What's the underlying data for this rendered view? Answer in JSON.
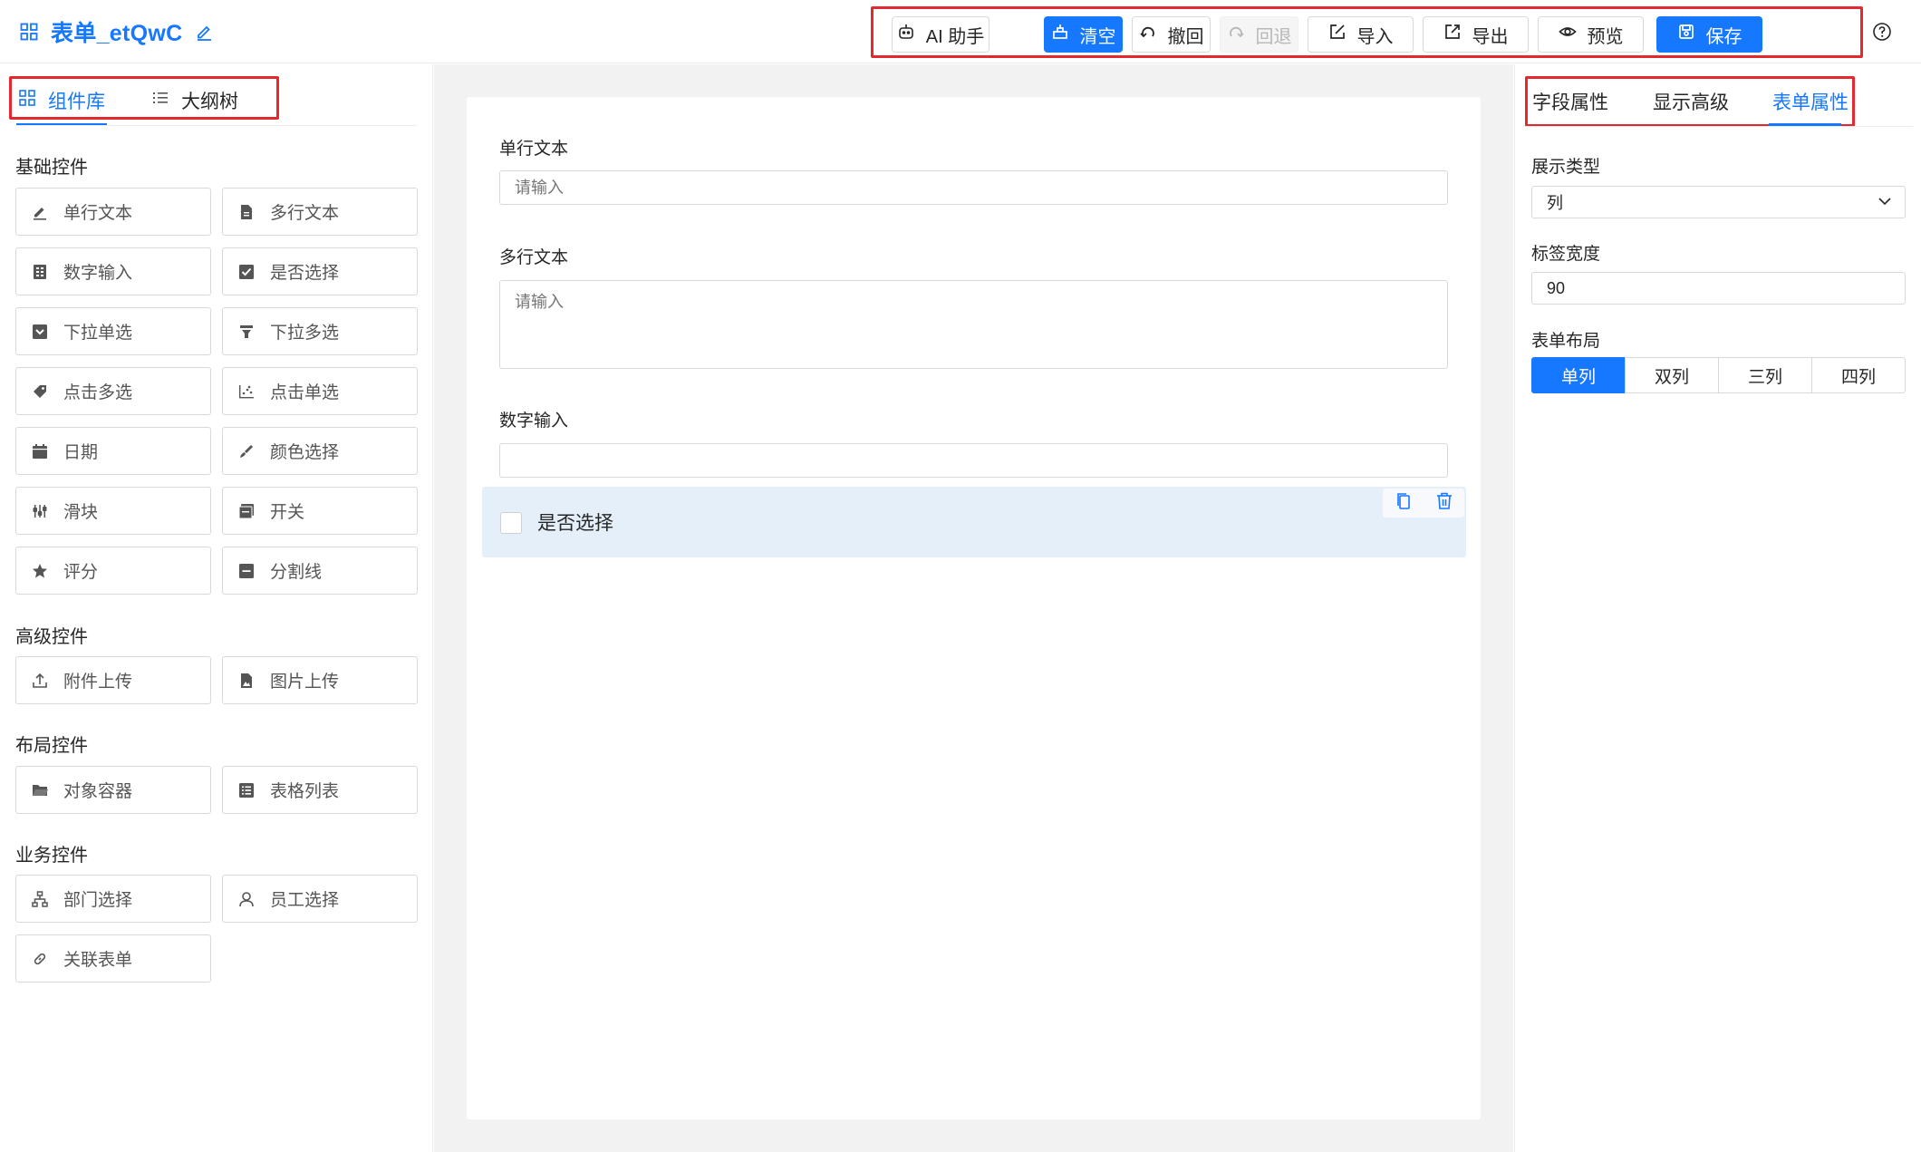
{
  "header": {
    "title": "表单_etQwC",
    "toolbar": [
      {
        "label": "AI 助手",
        "icon": "ai-robot-icon",
        "state": "default"
      },
      {
        "label": "清空",
        "icon": "clear-broom-icon",
        "state": "primary"
      },
      {
        "label": "撤回",
        "icon": "undo-icon",
        "state": "default"
      },
      {
        "label": "回退",
        "icon": "redo-icon",
        "state": "disabled"
      },
      {
        "label": "导入",
        "icon": "import-icon",
        "state": "default"
      },
      {
        "label": "导出",
        "icon": "export-icon",
        "state": "default"
      },
      {
        "label": "预览",
        "icon": "eye-icon",
        "state": "default"
      },
      {
        "label": "保存",
        "icon": "save-icon",
        "state": "primary"
      }
    ]
  },
  "left_panel": {
    "tabs": [
      {
        "label": "组件库",
        "icon": "grid-icon",
        "active": true
      },
      {
        "label": "大纲树",
        "icon": "list-icon",
        "active": false
      }
    ],
    "sections": {
      "basic": {
        "title": "基础控件",
        "items": [
          {
            "label": "单行文本",
            "icon": "pen-icon"
          },
          {
            "label": "多行文本",
            "icon": "document-icon"
          },
          {
            "label": "数字输入",
            "icon": "calculator-icon"
          },
          {
            "label": "是否选择",
            "icon": "checkbox-icon"
          },
          {
            "label": "下拉单选",
            "icon": "dropdown-square-icon"
          },
          {
            "label": "下拉多选",
            "icon": "filter-icon"
          },
          {
            "label": "点击多选",
            "icon": "tags-icon"
          },
          {
            "label": "点击单选",
            "icon": "scatter-icon"
          },
          {
            "label": "日期",
            "icon": "calendar-icon"
          },
          {
            "label": "颜色选择",
            "icon": "brush-icon"
          },
          {
            "label": "滑块",
            "icon": "slider-icon"
          },
          {
            "label": "开关",
            "icon": "switch-icon"
          },
          {
            "label": "评分",
            "icon": "star-icon"
          },
          {
            "label": "分割线",
            "icon": "divider-icon"
          }
        ]
      },
      "advanced": {
        "title": "高级控件",
        "items": [
          {
            "label": "附件上传",
            "icon": "upload-icon"
          },
          {
            "label": "图片上传",
            "icon": "image-file-icon"
          }
        ]
      },
      "layout": {
        "title": "布局控件",
        "items": [
          {
            "label": "对象容器",
            "icon": "folder-icon"
          },
          {
            "label": "表格列表",
            "icon": "table-list-icon"
          }
        ]
      },
      "business": {
        "title": "业务控件",
        "items": [
          {
            "label": "部门选择",
            "icon": "org-chart-icon"
          },
          {
            "label": "员工选择",
            "icon": "user-icon"
          },
          {
            "label": "关联表单",
            "icon": "link-icon"
          }
        ]
      }
    }
  },
  "canvas": {
    "fields": [
      {
        "label": "单行文本",
        "placeholder": "请输入"
      },
      {
        "label": "多行文本",
        "placeholder": "请输入"
      },
      {
        "label": "数字输入",
        "placeholder": ""
      }
    ],
    "checkbox_field": {
      "label": "是否选择",
      "checked": false,
      "selected": true
    }
  },
  "right_panel": {
    "tabs": [
      {
        "label": "字段属性",
        "active": false
      },
      {
        "label": "显示高级",
        "active": false
      },
      {
        "label": "表单属性",
        "active": true
      }
    ],
    "display_type": {
      "label": "展示类型",
      "value": "列"
    },
    "label_width": {
      "label": "标签宽度",
      "value": "90"
    },
    "form_layout": {
      "label": "表单布局",
      "options": [
        "单列",
        "双列",
        "三列",
        "四列"
      ],
      "selected": "单列"
    }
  },
  "colors": {
    "accent": "#1677ff",
    "highlight_border": "#e5282d",
    "selected_row": "#e4effa"
  }
}
